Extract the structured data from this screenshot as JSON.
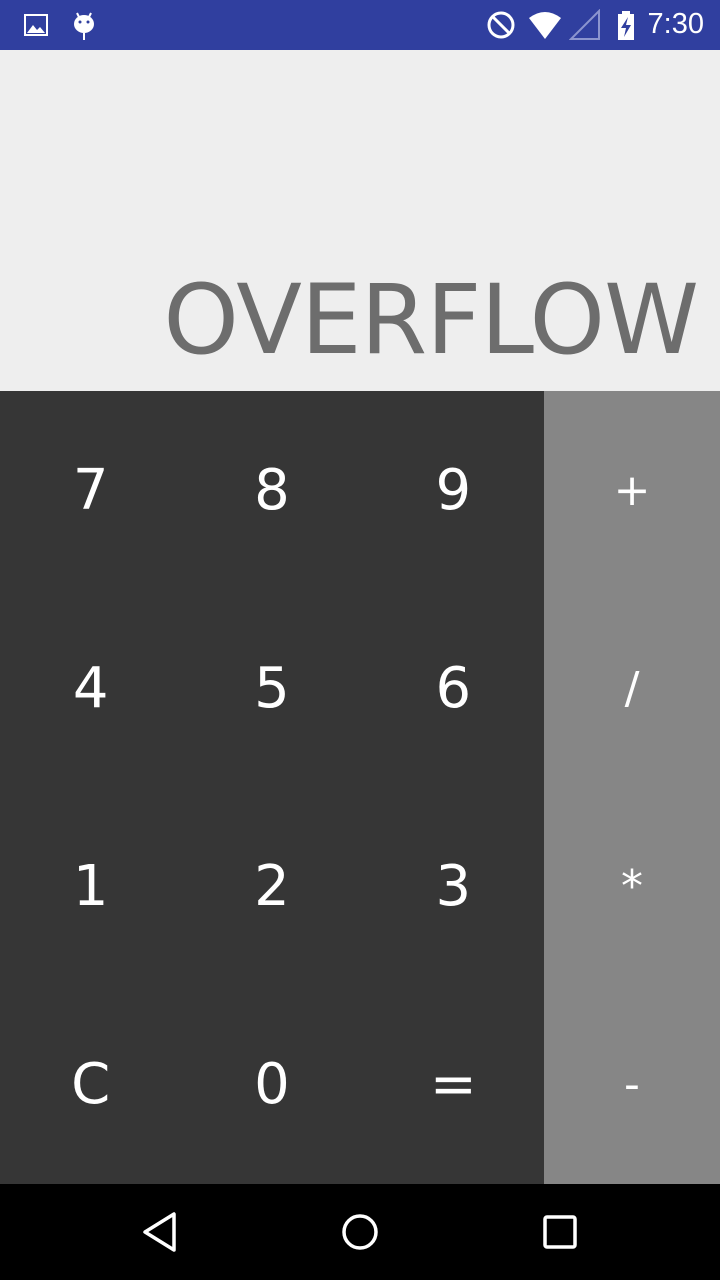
{
  "status_bar": {
    "time": "7:30",
    "left_icons": [
      "image-icon",
      "android-debug-icon"
    ],
    "right_icons": [
      "do-not-disturb-icon",
      "wifi-icon",
      "signal-icon",
      "battery-charging-icon"
    ],
    "background": "#303f9f"
  },
  "display": {
    "result": "OVERFLOW",
    "background": "#eeeeee",
    "text_color": "#6d6d6d"
  },
  "keypad": {
    "keys": [
      "7",
      "8",
      "9",
      "4",
      "5",
      "6",
      "1",
      "2",
      "3",
      "C",
      "0",
      "="
    ],
    "background": "#363636"
  },
  "operators": {
    "keys": [
      "+",
      "/",
      "*",
      "-"
    ],
    "background": "#868686"
  },
  "nav_bar": {
    "buttons": [
      "back-icon",
      "home-icon",
      "recents-icon"
    ]
  }
}
